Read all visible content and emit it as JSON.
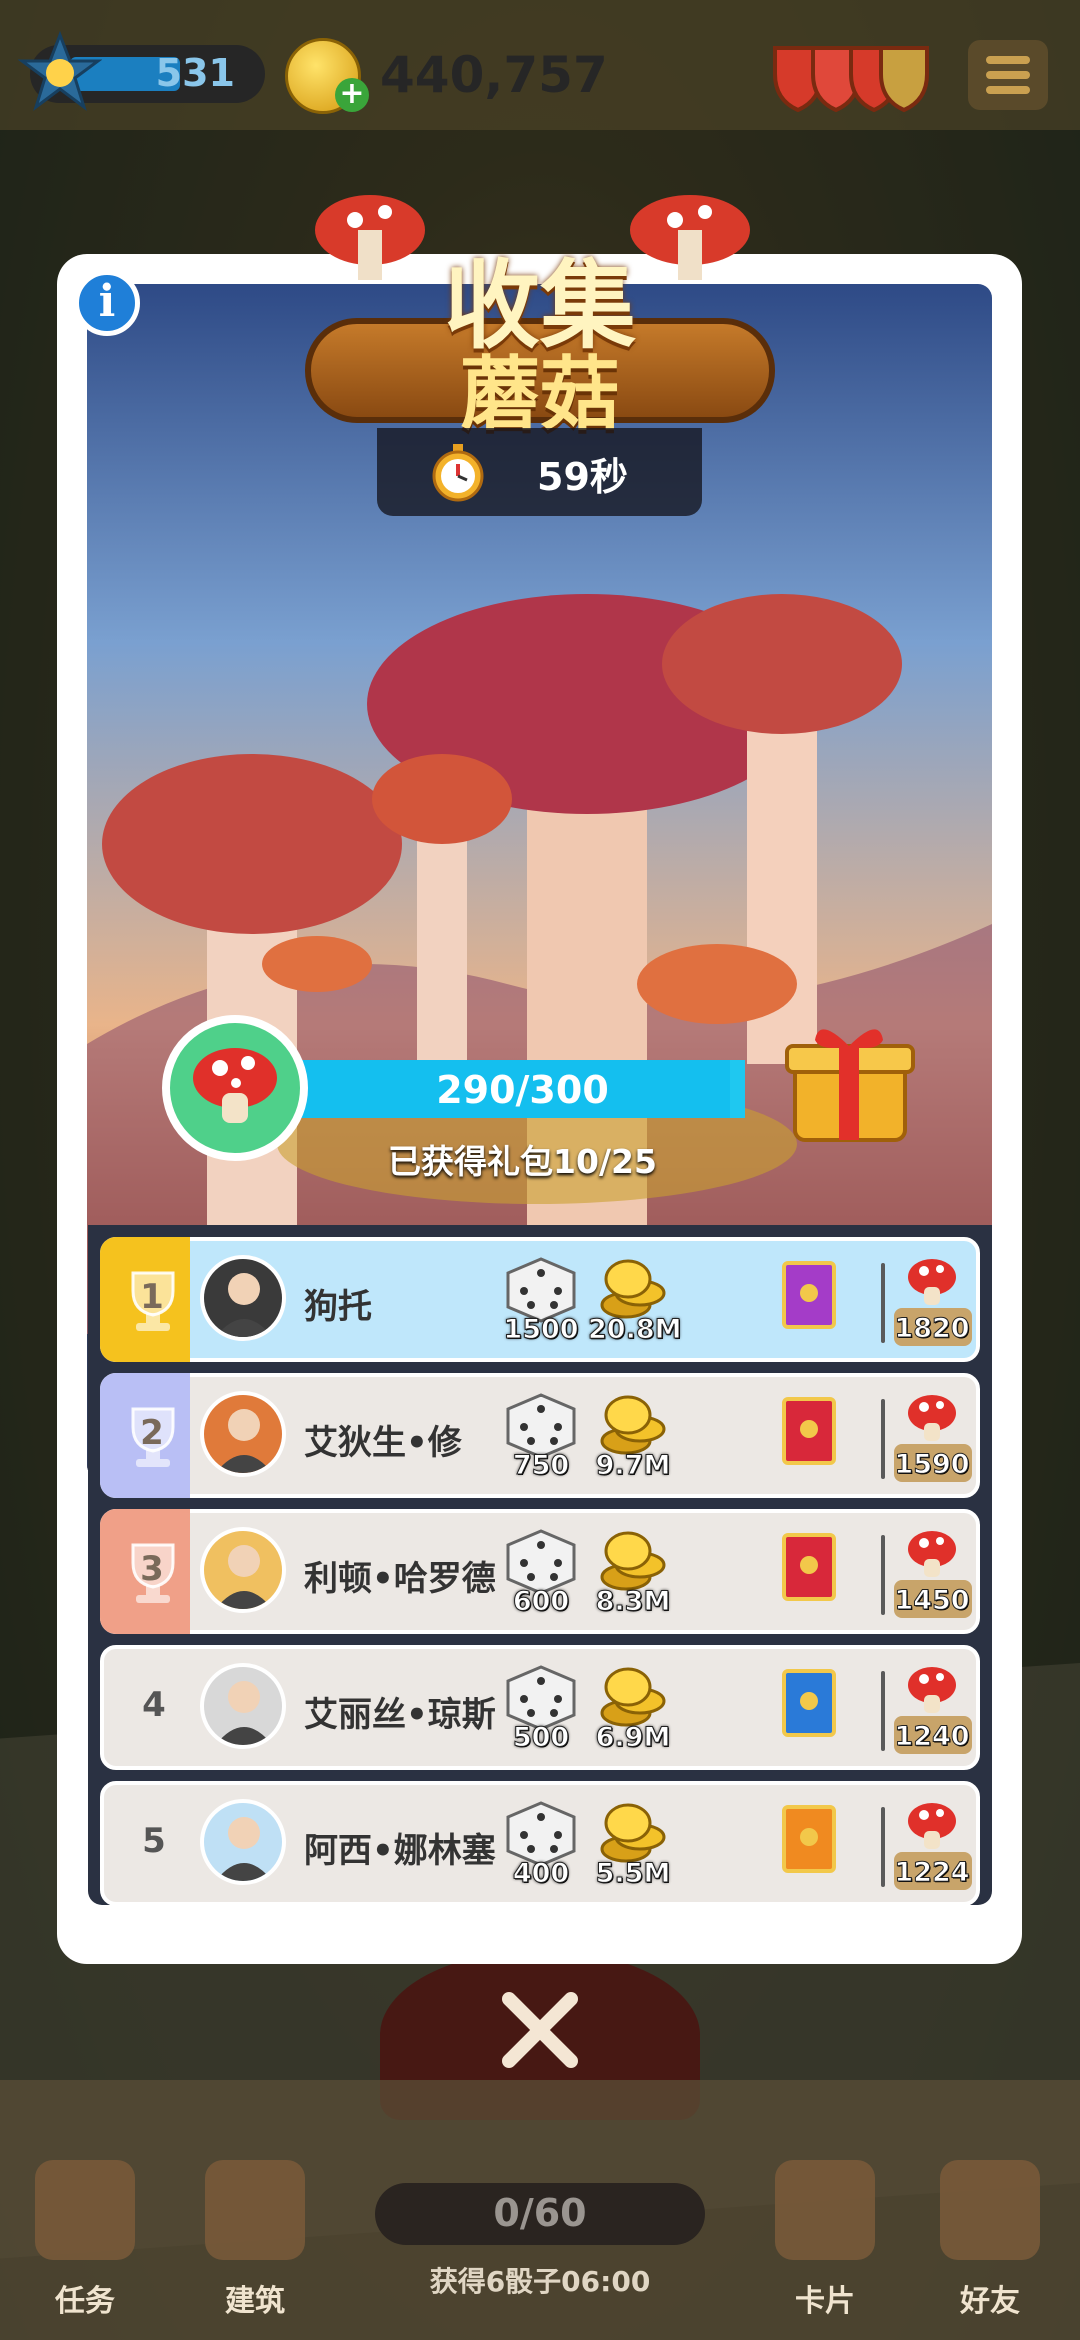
{
  "top_bar": {
    "level": "531",
    "coins": "440,757",
    "level_icon": "anchor-star-icon",
    "coin_icon": "gold-coin-icon",
    "shield_icon": "shields-icon",
    "menu_icon": "hamburger-menu-icon"
  },
  "event": {
    "title_line1": "收集",
    "title_line2": "蘑菇",
    "timer": "59秒",
    "progress_text": "290/300",
    "progress_fraction": 0.9667,
    "packs_text": "已获得礼包10/25"
  },
  "leaderboard": [
    {
      "rank": "1",
      "name": "狗托",
      "dice": "1500",
      "coins": "20.8M",
      "pack_color": "#a43cc8",
      "mushrooms": "1820",
      "tab_color": "#f5c21e",
      "avatar_color": "#3a3a3a"
    },
    {
      "rank": "2",
      "name": "艾狄生•修",
      "dice": "750",
      "coins": "9.7M",
      "pack_color": "#d8283a",
      "mushrooms": "1590",
      "tab_color": "#b9bff5",
      "avatar_color": "#e07a3a"
    },
    {
      "rank": "3",
      "name": "利顿•哈罗德",
      "dice": "600",
      "coins": "8.3M",
      "pack_color": "#d8283a",
      "mushrooms": "1450",
      "tab_color": "#f0a088",
      "avatar_color": "#f0c060"
    },
    {
      "rank": "4",
      "name": "艾丽丝•琼斯",
      "dice": "500",
      "coins": "6.9M",
      "pack_color": "#2a7ad8",
      "mushrooms": "1240",
      "tab_color": "",
      "avatar_color": "#d8d8d8"
    },
    {
      "rank": "5",
      "name": "阿西•娜林塞",
      "dice": "400",
      "coins": "5.5M",
      "pack_color": "#f08a20",
      "mushrooms": "1224",
      "tab_color": "",
      "avatar_color": "#bfe0f5"
    }
  ],
  "bottom_nav": {
    "items": [
      {
        "label": "任务",
        "icon": "tasks-icon"
      },
      {
        "label": "建筑",
        "icon": "build-icon"
      },
      {
        "label": "卡片",
        "icon": "cards-icon"
      },
      {
        "label": "好友",
        "icon": "friends-icon"
      }
    ],
    "dice_count": "0/60",
    "dice_timer": "获得6骰子06:00"
  },
  "colors": {
    "accent": "#1fc8f0",
    "row_highlight": "#bfe7fb",
    "row_default": "#ece8e4"
  }
}
